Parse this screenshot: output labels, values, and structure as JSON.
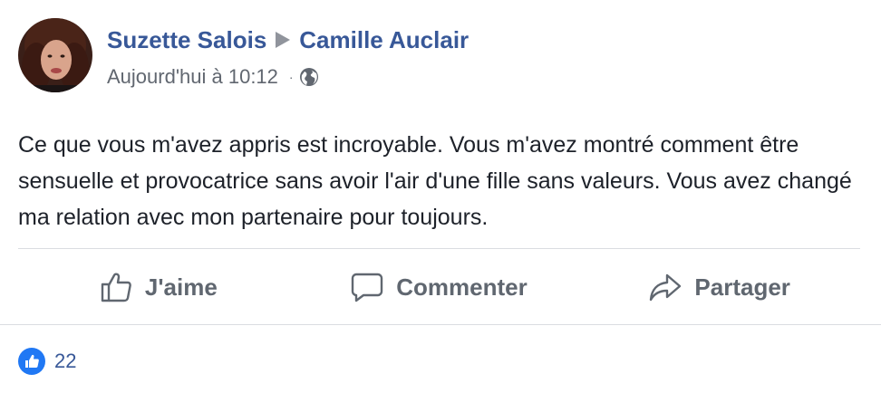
{
  "post": {
    "author": "Suzette Salois",
    "recipient": "Camille Auclair",
    "timestamp": "Aujourd'hui à 10:12",
    "separator": "·",
    "privacy_icon": "globe-icon",
    "text": "Ce que vous m'avez appris est incroyable. Vous m'avez montré comment être sensuelle et provocatrice sans avoir l'air d'une fille sans valeurs. Vous avez changé ma relation avec mon partenaire pour toujours."
  },
  "actions": {
    "like_label": "J'aime",
    "comment_label": "Commenter",
    "share_label": "Partager"
  },
  "reactions": {
    "count": "22",
    "icon": "thumbs-up-icon"
  },
  "colors": {
    "link": "#385898",
    "muted": "#606770",
    "like_blue": "#2078f4",
    "divider": "#dadde1"
  }
}
